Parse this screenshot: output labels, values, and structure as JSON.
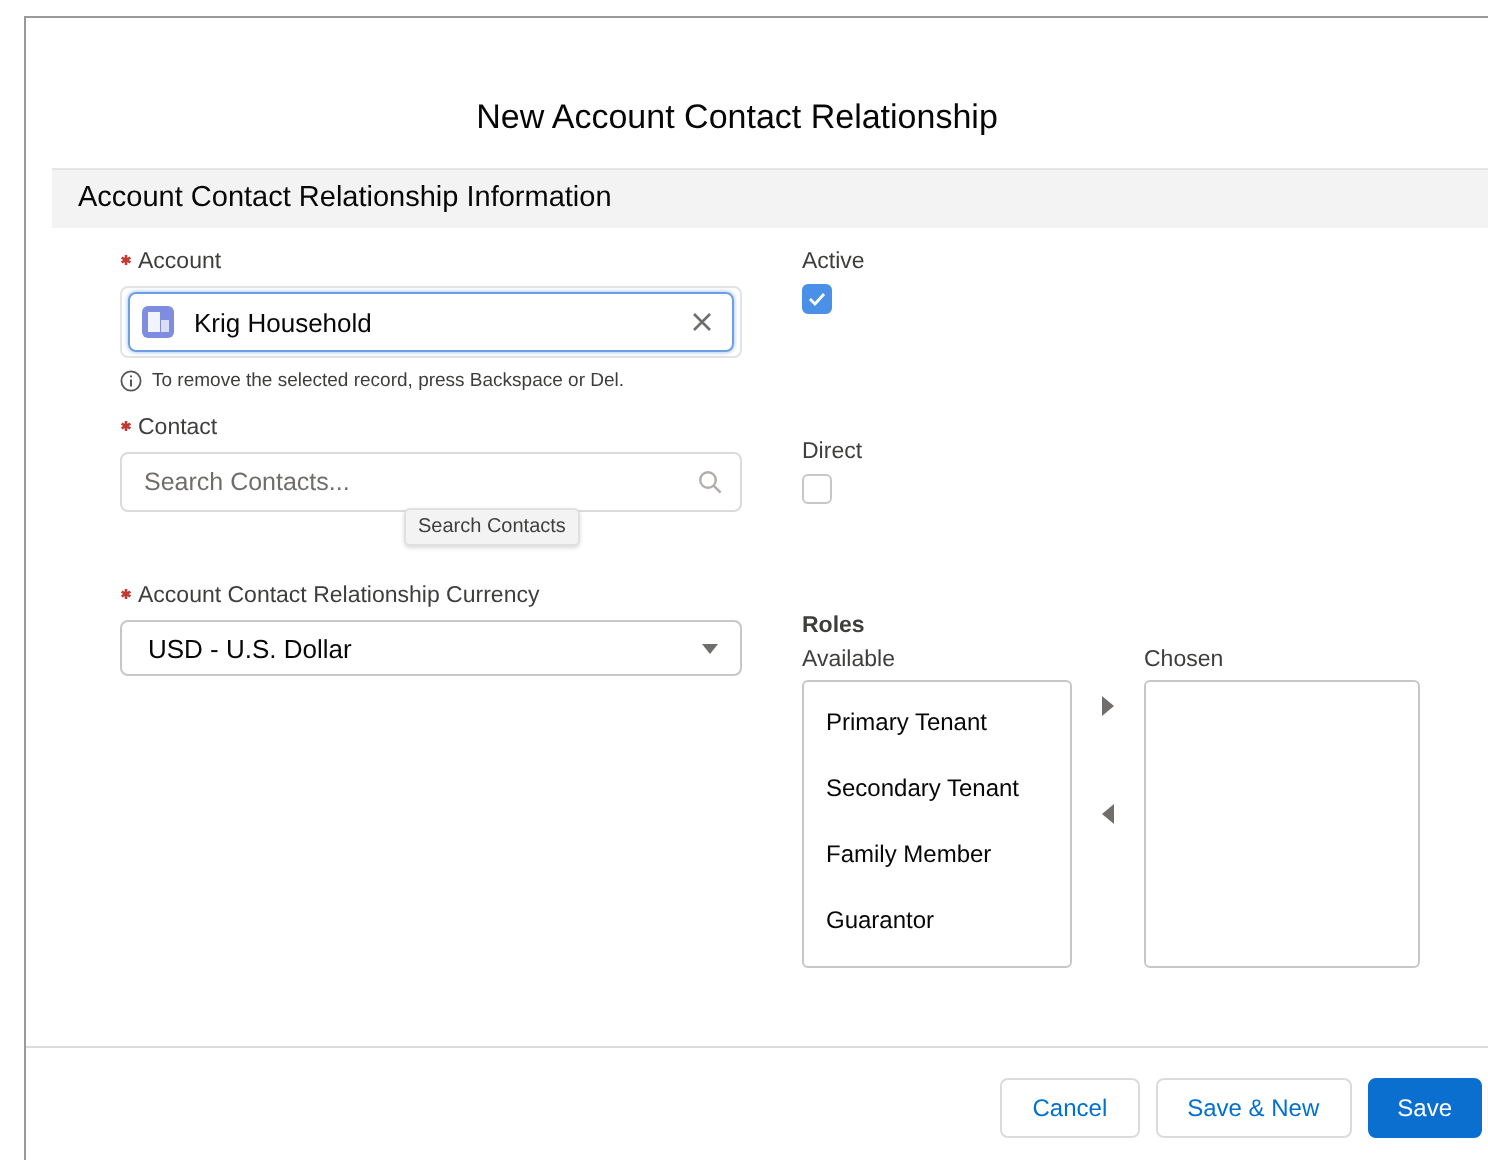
{
  "modal": {
    "title": "New Account Contact Relationship"
  },
  "section": {
    "title": "Account Contact Relationship Information"
  },
  "left_fields": [
    {
      "kind": "lookup",
      "label": "Account",
      "required": true,
      "value": "Krig Household",
      "help": "To remove the selected record, press Backspace or Del."
    },
    {
      "kind": "search",
      "label": "Contact",
      "required": true,
      "placeholder": "Search Contacts...",
      "tooltip": "Search Contacts"
    },
    {
      "kind": "select",
      "label": "Account Contact Relationship Currency",
      "required": true,
      "value": "USD - U.S. Dollar"
    }
  ],
  "checkboxes": [
    {
      "label": "Active",
      "checked": true
    },
    {
      "label": "Direct",
      "checked": false
    }
  ],
  "roles": {
    "title": "Roles",
    "available_label": "Available",
    "chosen_label": "Chosen",
    "available": [
      "Primary Tenant",
      "Secondary Tenant",
      "Family Member",
      "Guarantor"
    ]
  },
  "buttons": [
    {
      "label": "Cancel",
      "kind": "neutral"
    },
    {
      "label": "Save & New",
      "kind": "neutral"
    },
    {
      "label": "Save",
      "kind": "brand"
    }
  ]
}
